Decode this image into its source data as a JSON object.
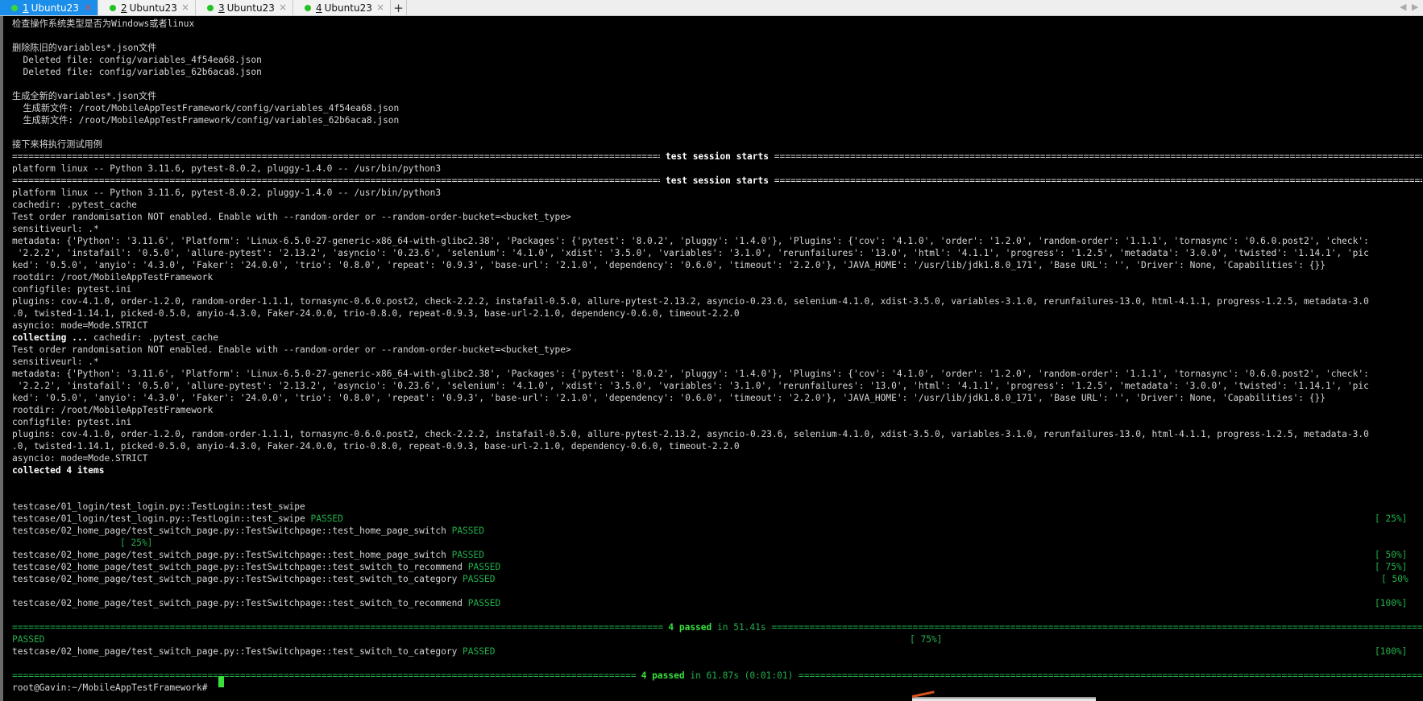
{
  "tabs": [
    {
      "num": "1",
      "title": "Ubuntu23",
      "close": "×",
      "active": true
    },
    {
      "num": "2",
      "title": "Ubuntu23",
      "close": "×",
      "active": false
    },
    {
      "num": "3",
      "title": "Ubuntu23",
      "close": "×",
      "active": false
    },
    {
      "num": "4",
      "title": "Ubuntu23",
      "close": "×",
      "active": false
    }
  ],
  "tabbar": {
    "add": "+",
    "nav_left": "◀",
    "nav_right": "▶"
  },
  "terminal": {
    "lines": [
      "检查操作系统类型是否为Windows或者linux",
      "",
      "删除陈旧的variables*.json文件",
      "  Deleted file: config/variables_4f54ea68.json",
      "  Deleted file: config/variables_62b6aca8.json",
      "",
      "生成全新的variables*.json文件",
      "  生成新文件: /root/MobileAppTestFramework/config/variables_4f54ea68.json",
      "  生成新文件: /root/MobileAppTestFramework/config/variables_62b6aca8.json",
      "",
      "接下来将执行测试用例",
      "",
      "platform linux -- Python 3.11.6, pytest-8.0.2, pluggy-1.4.0 -- /usr/bin/python3",
      "",
      "platform linux -- Python 3.11.6, pytest-8.0.2, pluggy-1.4.0 -- /usr/bin/python3",
      "cachedir: .pytest_cache",
      "Test order randomisation NOT enabled. Enable with --random-order or --random-order-bucket=<bucket_type>",
      "sensitiveurl: .*",
      "metadata: {'Python': '3.11.6', 'Platform': 'Linux-6.5.0-27-generic-x86_64-with-glibc2.38', 'Packages': {'pytest': '8.0.2', 'pluggy': '1.4.0'}, 'Plugins': {'cov': '4.1.0', 'order': '1.2.0', 'random-order': '1.1.1', 'tornasync': '0.6.0.post2', 'check':",
      " '2.2.2', 'instafail': '0.5.0', 'allure-pytest': '2.13.2', 'asyncio': '0.23.6', 'selenium': '4.1.0', 'xdist': '3.5.0', 'variables': '3.1.0', 'rerunfailures': '13.0', 'html': '4.1.1', 'progress': '1.2.5', 'metadata': '3.0.0', 'twisted': '1.14.1', 'pic",
      "ked': '0.5.0', 'anyio': '4.3.0', 'Faker': '24.0.0', 'trio': '0.8.0', 'repeat': '0.9.3', 'base-url': '2.1.0', 'dependency': '0.6.0', 'timeout': '2.2.0'}, 'JAVA_HOME': '/usr/lib/jdk1.8.0_171', 'Base URL': '', 'Driver': None, 'Capabilities': {}}",
      "rootdir: /root/MobileAppTestFramework",
      "configfile: pytest.ini",
      "plugins: cov-4.1.0, order-1.2.0, random-order-1.1.1, tornasync-0.6.0.post2, check-2.2.2, instafail-0.5.0, allure-pytest-2.13.2, asyncio-0.23.6, selenium-4.1.0, xdist-3.5.0, variables-3.1.0, rerunfailures-13.0, html-4.1.1, progress-1.2.5, metadata-3.0",
      ".0, twisted-1.14.1, picked-0.5.0, anyio-4.3.0, Faker-24.0.0, trio-0.8.0, repeat-0.9.3, base-url-2.1.0, dependency-0.6.0, timeout-2.2.0",
      "asyncio: mode=Mode.STRICT",
      " cachedir: .pytest_cache",
      "Test order randomisation NOT enabled. Enable with --random-order or --random-order-bucket=<bucket_type>",
      "sensitiveurl: .*",
      "metadata: {'Python': '3.11.6', 'Platform': 'Linux-6.5.0-27-generic-x86_64-with-glibc2.38', 'Packages': {'pytest': '8.0.2', 'pluggy': '1.4.0'}, 'Plugins': {'cov': '4.1.0', 'order': '1.2.0', 'random-order': '1.1.1', 'tornasync': '0.6.0.post2', 'check':",
      " '2.2.2', 'instafail': '0.5.0', 'allure-pytest': '2.13.2', 'asyncio': '0.23.6', 'selenium': '4.1.0', 'xdist': '3.5.0', 'variables': '3.1.0', 'rerunfailures': '13.0', 'html': '4.1.1', 'progress': '1.2.5', 'metadata': '3.0.0', 'twisted': '1.14.1', 'pic",
      "ked': '0.5.0', 'anyio': '4.3.0', 'Faker': '24.0.0', 'trio': '0.8.0', 'repeat': '0.9.3', 'base-url': '2.1.0', 'dependency': '0.6.0', 'timeout': '2.2.0'}, 'JAVA_HOME': '/usr/lib/jdk1.8.0_171', 'Base URL': '', 'Driver': None, 'Capabilities': {}}",
      "rootdir: /root/MobileAppTestFramework",
      "configfile: pytest.ini",
      "plugins: cov-4.1.0, order-1.2.0, random-order-1.1.1, tornasync-0.6.0.post2, check-2.2.2, instafail-0.5.0, allure-pytest-2.13.2, asyncio-0.23.6, selenium-4.1.0, xdist-3.5.0, variables-3.1.0, rerunfailures-13.0, html-4.1.1, progress-1.2.5, metadata-3.0",
      ".0, twisted-1.14.1, picked-0.5.0, anyio-4.3.0, Faker-24.0.0, trio-0.8.0, repeat-0.9.3, base-url-2.1.0, dependency-0.6.0, timeout-2.2.0",
      "asyncio: mode=Mode.STRICT"
    ],
    "collecting_label": "collecting ...",
    "collected": "collected 4 items",
    "session_starts": " test session starts ",
    "tests": [
      "testcase/01_login/test_login.py::TestLogin::test_swipe",
      "testcase/01_login/test_login.py::TestLogin::test_swipe ",
      "testcase/02_home_page/test_switch_page.py::TestSwitchpage::test_home_page_switch ",
      "testcase/02_home_page/test_switch_page.py::TestSwitchpage::test_home_page_switch ",
      "testcase/02_home_page/test_switch_page.py::TestSwitchpage::test_switch_to_recommend ",
      "testcase/02_home_page/test_switch_page.py::TestSwitchpage::test_switch_to_category ",
      "testcase/02_home_page/test_switch_page.py::TestSwitchpage::test_switch_to_recommend ",
      "testcase/02_home_page/test_switch_page.py::TestSwitchpage::test_switch_to_category "
    ],
    "passed_word": "PASSED",
    "percents": [
      "[ 25%]",
      "[ 25%]",
      "[ 50%]",
      "[ 75%]",
      "[ 50%",
      "[100%]",
      "[ 75%]",
      "[100%]"
    ],
    "summary1_label": " 4 passed",
    "summary1_dur": " in 51.41s ",
    "summary2_label": " 4 passed",
    "summary2_dur": " in 61.87s (0:01:01) ",
    "prompt": "root@Gavin:~/MobileAppTestFramework# "
  }
}
